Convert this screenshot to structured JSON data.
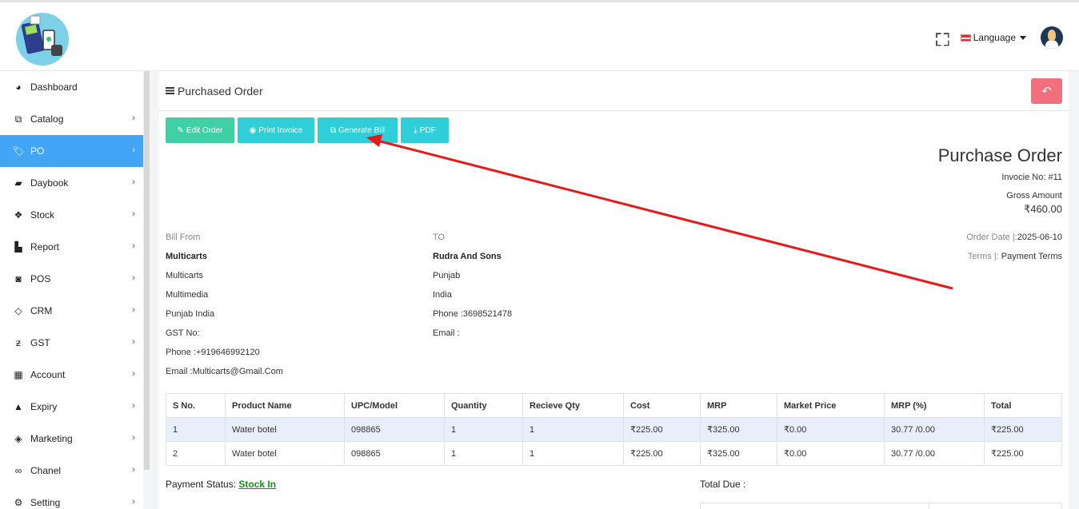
{
  "topbar": {
    "language_label": "Language"
  },
  "sidebar": {
    "items": [
      {
        "label": "Dashboard",
        "icon": "dashboard-icon",
        "chevron": false
      },
      {
        "label": "Catalog",
        "icon": "catalog-icon",
        "chevron": true
      },
      {
        "label": "PO",
        "icon": "tags-icon",
        "chevron": true,
        "active": true
      },
      {
        "label": "Daybook",
        "icon": "book-icon",
        "chevron": true
      },
      {
        "label": "Stock",
        "icon": "cubes-icon",
        "chevron": true
      },
      {
        "label": "Report",
        "icon": "bar-chart-icon",
        "chevron": true
      },
      {
        "label": "POS",
        "icon": "shopping-bag-icon",
        "chevron": true
      },
      {
        "label": "CRM",
        "icon": "diamond-icon",
        "chevron": true
      },
      {
        "label": "GST",
        "icon": "gst-icon",
        "chevron": true
      },
      {
        "label": "Account",
        "icon": "calculator-icon",
        "chevron": true
      },
      {
        "label": "Expiry",
        "icon": "warning-icon",
        "chevron": true
      },
      {
        "label": "Marketing",
        "icon": "tag-icon",
        "chevron": true
      },
      {
        "label": "Chanel",
        "icon": "link-icon",
        "chevron": true
      },
      {
        "label": "Setting",
        "icon": "gears-icon",
        "chevron": true
      }
    ]
  },
  "page": {
    "title": "Purchased Order",
    "buttons": {
      "edit": "Edit Order",
      "print": "Print Invoice",
      "generate": "Generate Bill",
      "pdf": "PDF"
    },
    "doc_title": "Purchase Order",
    "invoice_no": "Invocie No: #11",
    "gross_label": "Gross Amount",
    "gross_value": "₹460.00",
    "order_date_label": "Order Date |:",
    "order_date": "2025-06-10",
    "terms_label": "Terms |:",
    "terms_value": "Payment Terms"
  },
  "bill_from": {
    "heading": "Bill From",
    "name": "Multicarts",
    "lines": [
      "Multicarts",
      "Multimedia",
      "Punjab India",
      "GST No:",
      "Phone :+919646992120",
      "Email :Multicarts@Gmail.Com"
    ]
  },
  "bill_to": {
    "heading": "TO",
    "name": "Rudra And Sons",
    "lines": [
      "Punjab",
      "India",
      "Phone :3698521478",
      "Email :"
    ]
  },
  "table": {
    "headers": [
      "S No.",
      "Product Name",
      "UPC/Model",
      "Quantity",
      "Recieve Qty",
      "Cost",
      "MRP",
      "Market Price",
      "MRP (%)",
      "Total"
    ],
    "rows": [
      [
        "1",
        "Water botel",
        "098865",
        "1",
        "1",
        "₹225.00",
        "₹325.00",
        "₹0.00",
        "30.77 /0.00",
        "₹225.00"
      ],
      [
        "2",
        "Water botel",
        "098865",
        "1",
        "1",
        "₹225.00",
        "₹325.00",
        "₹0.00",
        "30.77 /0.00",
        "₹225.00"
      ]
    ]
  },
  "footer": {
    "payment_label": "Payment Status:",
    "payment_status": "Stock In",
    "total_due_label": "Total Due :"
  },
  "colors": {
    "active_nav": "#42a5f5",
    "edit_button": "#3fd0a6",
    "action_button": "#2ecfd8",
    "back_button": "#f46f7d",
    "annotation_arrow": "#e51b1b"
  }
}
